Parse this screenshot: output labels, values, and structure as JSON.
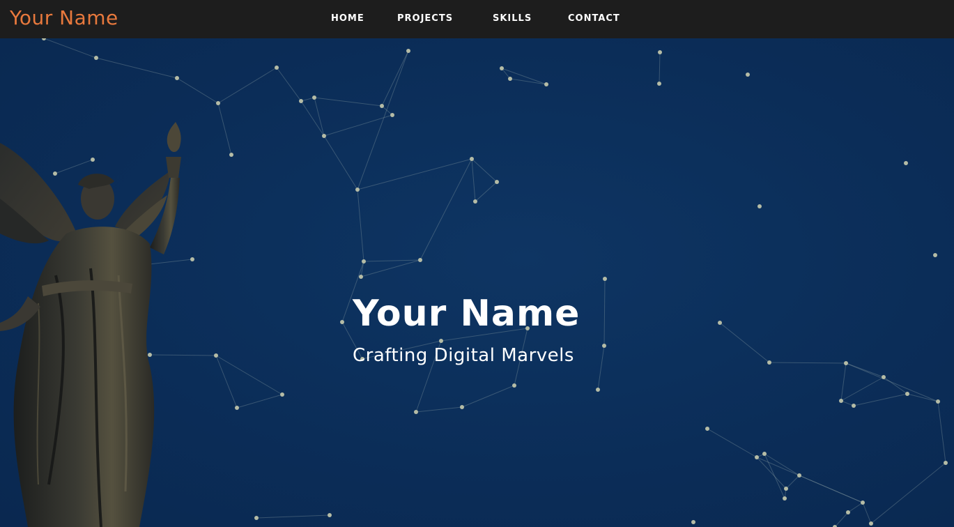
{
  "navbar": {
    "brand": "Your Name",
    "links": [
      {
        "label": "HOME"
      },
      {
        "label": "PROJECTS"
      },
      {
        "label": "SKILLS"
      },
      {
        "label": "CONTACT"
      }
    ],
    "theme_toggle_icon": "crescent-moon-icon"
  },
  "hero": {
    "title": "Your Name",
    "subtitle": "Crafting Digital Marvels",
    "background_image": "angel-statue-with-torch"
  },
  "colors": {
    "navbar_bg": "#1d1d1d",
    "brand": "#e8793d",
    "hero_bg": "#0b2d58",
    "particle": "#b5bca6",
    "text": "#ffffff"
  }
}
